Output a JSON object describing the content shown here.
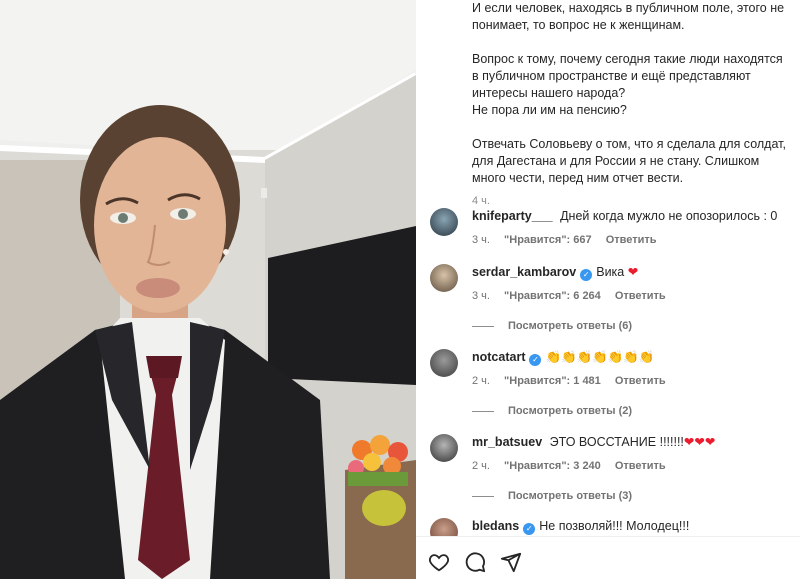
{
  "caption": {
    "para1": "И если человек, находясь в публичном поле, этого не понимает, то вопрос не к женщинам.",
    "para2a": "Вопрос к тому, почему сегодня такие люди находятся в публичном пространстве и ещё представляют интересы нашего народа?",
    "para2b": "Не пора ли им на пенсию?",
    "para3": "Отвечать Соловьеву о том, что я сделала для солдат, для Дагестана и для России я не стану. Слишком много чести, перед ним отчет вести.",
    "time": "4 ч."
  },
  "comments": [
    {
      "user": "knifeparty___",
      "verified": false,
      "text": "Дней когда мужло не опозорилось : 0",
      "time": "3 ч.",
      "likes": "\"Нравится\": 667",
      "reply": "Ответить"
    },
    {
      "user": "serdar_kambarov",
      "verified": true,
      "text": "Вика",
      "emoji": "❤",
      "time": "3 ч.",
      "likes": "\"Нравится\": 6 264",
      "reply": "Ответить",
      "replies": "Посмотреть ответы (6)"
    },
    {
      "user": "notcatart",
      "verified": true,
      "text": "👏👏👏👏👏👏👏",
      "time": "2 ч.",
      "likes": "\"Нравится\": 1 481",
      "reply": "Ответить",
      "replies": "Посмотреть ответы (2)"
    },
    {
      "user": "mr_batsuev",
      "verified": false,
      "text": "ЭТО ВОССТАНИЕ !!!!!!!",
      "emoji": "❤❤❤",
      "time": "2 ч.",
      "likes": "\"Нравится\": 3 240",
      "reply": "Ответить",
      "replies": "Посмотреть ответы (3)"
    },
    {
      "user": "bledans",
      "verified": true,
      "text": "Не позволяй!!! Молодец!!!"
    }
  ],
  "actions": [
    "heart-icon",
    "comment-icon",
    "share-icon"
  ],
  "colors": {
    "accent": "#3897f0",
    "heart": "#ed1b2e",
    "muted": "#737373"
  }
}
